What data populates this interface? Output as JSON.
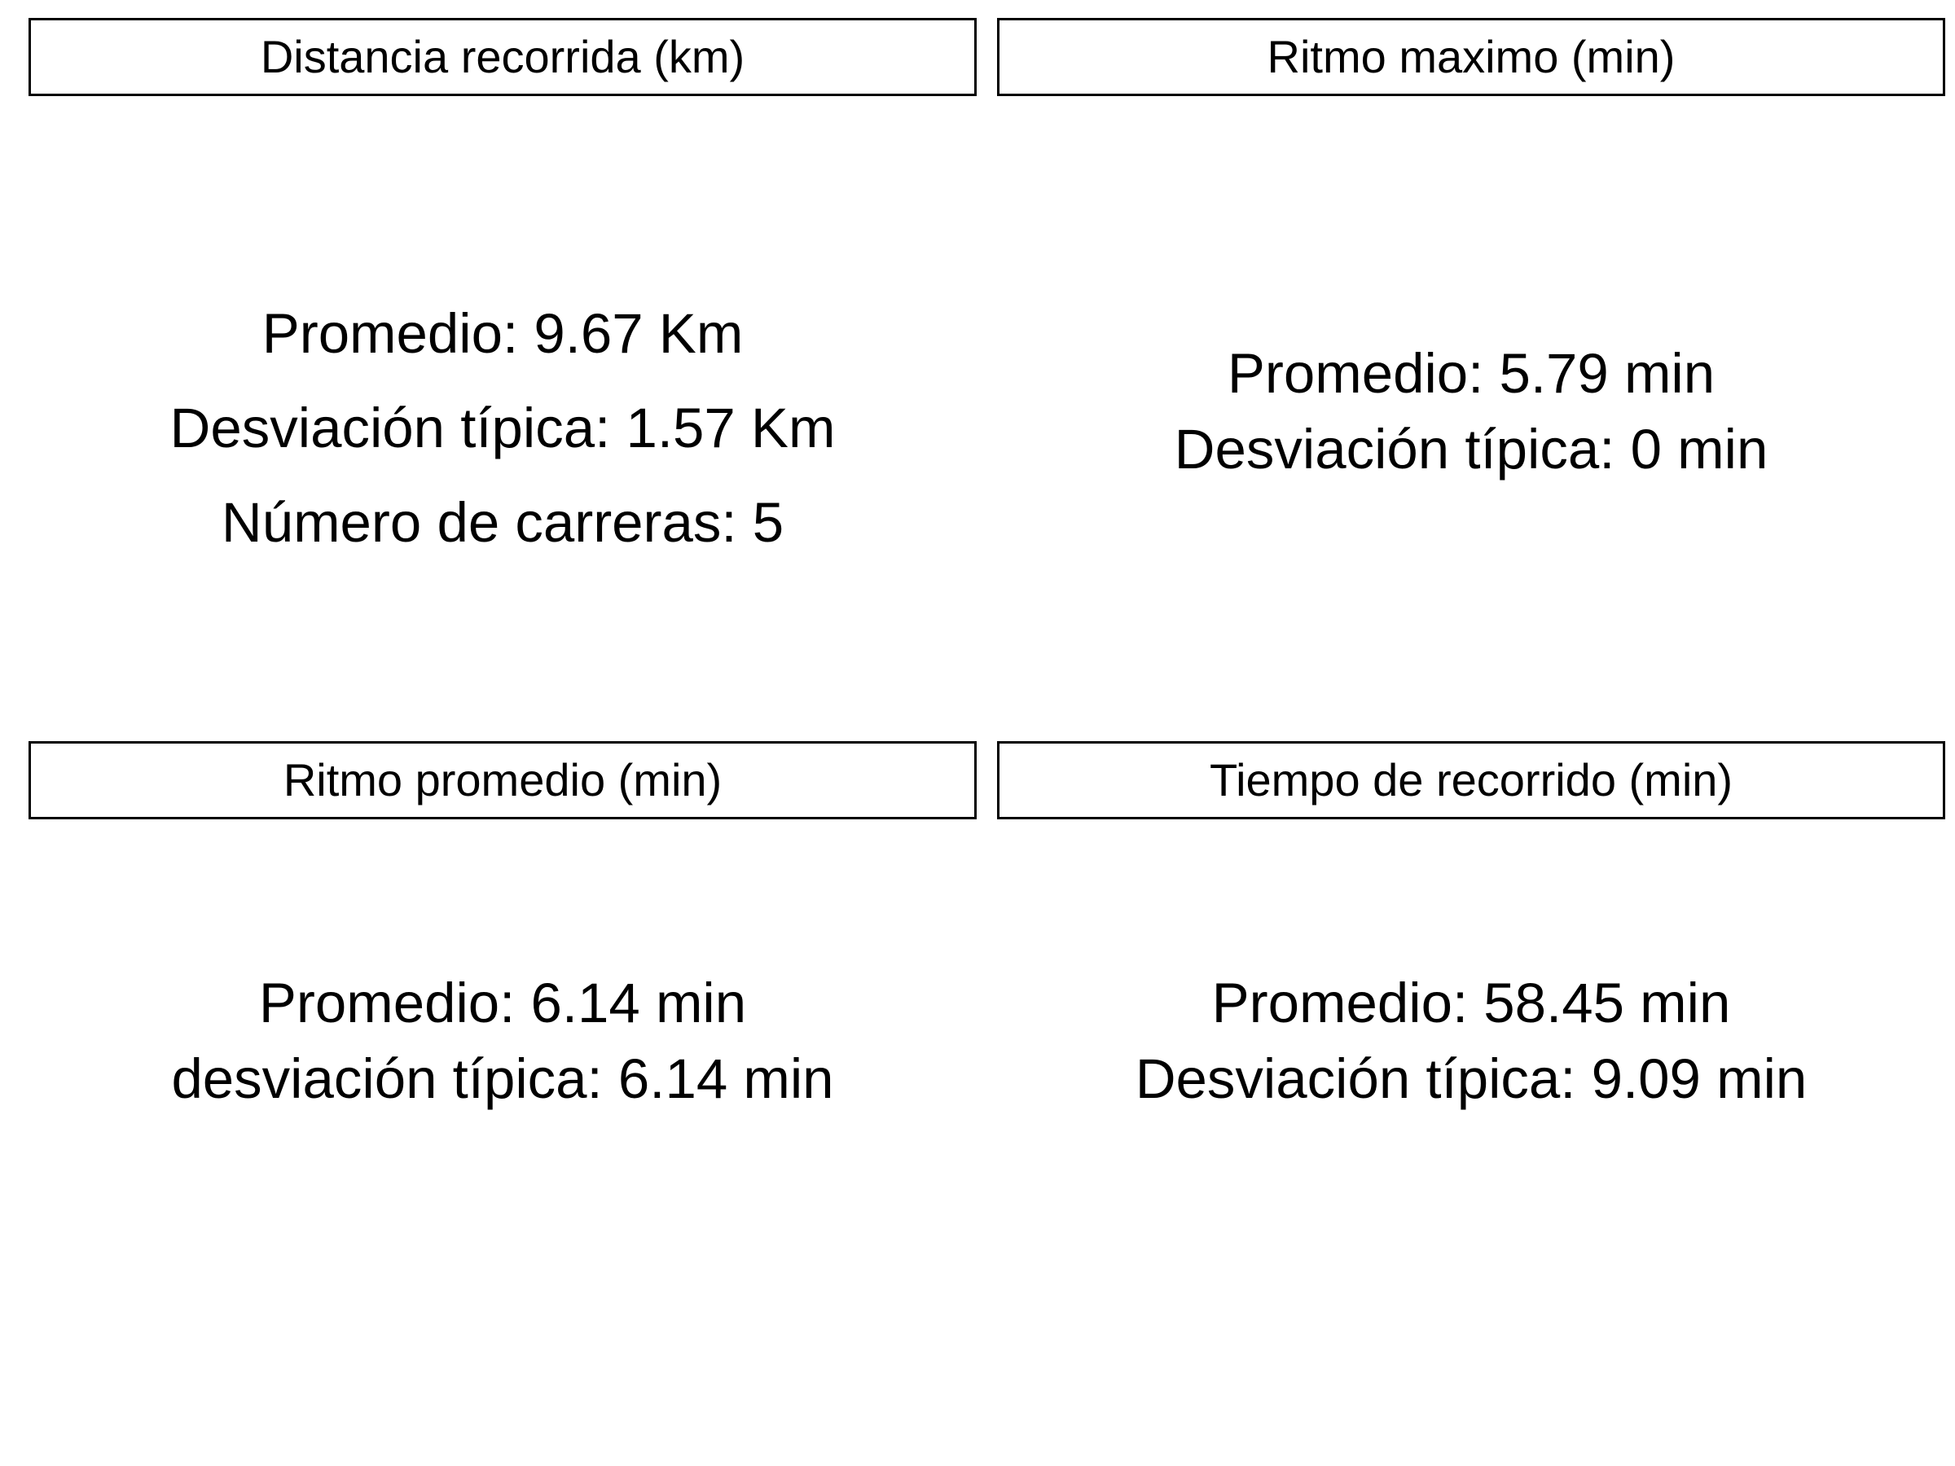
{
  "panels": [
    {
      "title": "Distancia recorrida (km)",
      "lines": [
        "Promedio: 9.67 Km",
        "Desviación típica: 1.57 Km",
        "Número de carreras: 5"
      ]
    },
    {
      "title": "Ritmo maximo (min)",
      "lines": [
        "Promedio: 5.79 min",
        "Desviación típica: 0 min"
      ]
    },
    {
      "title": "Ritmo promedio (min)",
      "lines": [
        "Promedio: 6.14 min",
        "desviación típica: 6.14 min"
      ]
    },
    {
      "title": "Tiempo de recorrido (min)",
      "lines": [
        "Promedio: 58.45 min",
        "Desviación típica: 9.09 min"
      ]
    }
  ]
}
